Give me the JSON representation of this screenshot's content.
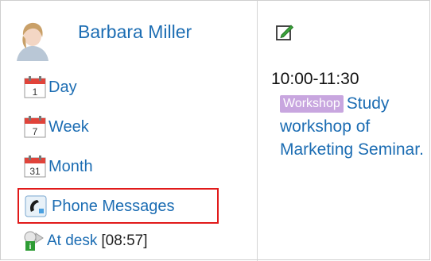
{
  "user": {
    "name": "Barbara Miller"
  },
  "calendar_links": [
    {
      "label": "Day",
      "day_number": "1"
    },
    {
      "label": "Week",
      "day_number": "7"
    },
    {
      "label": "Month",
      "day_number": "31"
    }
  ],
  "phone_messages": {
    "label": "Phone Messages"
  },
  "presence": {
    "label": "At desk",
    "time": "[08:57]"
  },
  "event": {
    "time": "10:00-11:30",
    "tag": "Workshop",
    "title": "Study workshop of Marketing Seminar."
  },
  "colors": {
    "link": "#1c6db3",
    "highlight_border": "#e11a1a",
    "badge_bg": "#c8a6df",
    "calendar_red": "#e0433a"
  },
  "icons": {
    "avatar": "user-avatar",
    "calendar": "calendar-icon",
    "phone": "phone-icon",
    "presence": "presence-icon",
    "edit": "edit-icon"
  }
}
